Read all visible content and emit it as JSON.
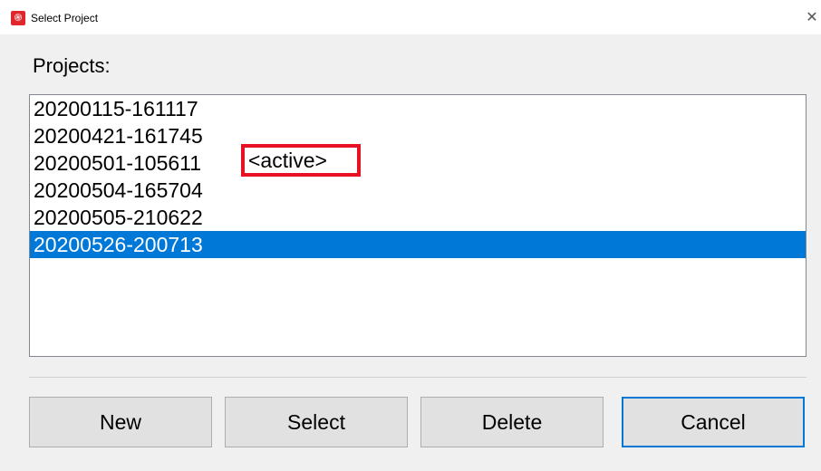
{
  "window": {
    "title": "Select Project",
    "close_glyph": "✕",
    "app_icon": "app-logo-icon",
    "app_icon_glyph": "֍"
  },
  "projects_label": "Projects:",
  "projects": [
    {
      "name": "20200115-161117"
    },
    {
      "name": "20200421-161745"
    },
    {
      "name": "20200501-105611",
      "tag": "<active>"
    },
    {
      "name": "20200504-165704"
    },
    {
      "name": "20200505-210622"
    },
    {
      "name": "20200526-200713",
      "selected": true
    }
  ],
  "buttons": {
    "new": "New",
    "select": "Select",
    "delete": "Delete",
    "cancel": "Cancel"
  },
  "colors": {
    "selection": "#0078d7",
    "highlight_box": "#e81123",
    "app_icon": "#e0262b"
  }
}
